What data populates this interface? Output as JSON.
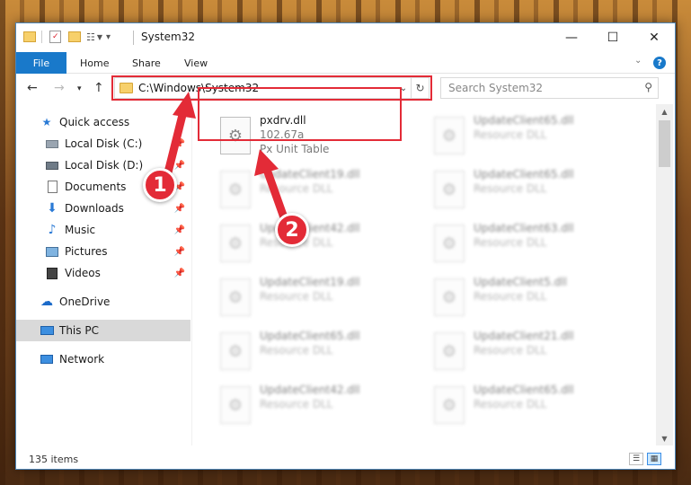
{
  "window": {
    "title": "System32",
    "controls": {
      "minimize": "—",
      "maximize": "☐",
      "close": "✕"
    }
  },
  "ribbon": {
    "tabs": [
      "File",
      "Home",
      "Share",
      "View"
    ],
    "help": "?"
  },
  "nav": {
    "address": "C:\\Windows\\System32",
    "search_placeholder": "Search System32"
  },
  "sidebar": {
    "items": [
      {
        "label": "Quick access",
        "icon": "star-icon"
      },
      {
        "label": "Local Disk (C:)",
        "icon": "drive-icon",
        "pinned": true
      },
      {
        "label": "Local Disk (D:)",
        "icon": "drive-icon",
        "pinned": true
      },
      {
        "label": "Documents",
        "icon": "documents-icon",
        "pinned": true
      },
      {
        "label": "Downloads",
        "icon": "download-icon",
        "pinned": true
      },
      {
        "label": "Music",
        "icon": "music-icon",
        "pinned": true
      },
      {
        "label": "Pictures",
        "icon": "pictures-icon",
        "pinned": true
      },
      {
        "label": "Videos",
        "icon": "videos-icon",
        "pinned": true
      },
      {
        "label": "OneDrive",
        "icon": "cloud-icon"
      },
      {
        "label": "This PC",
        "icon": "computer-icon"
      },
      {
        "label": "Network",
        "icon": "network-icon"
      }
    ]
  },
  "files": {
    "highlighted": {
      "name": "pxdrv.dll",
      "version": "102.67a",
      "description": "Px Unit Table"
    },
    "col1": [
      {
        "name": "UpdateClient19.dll",
        "type": "Resource DLL"
      },
      {
        "name": "UpdateClient42.dll",
        "type": "Resource DLL"
      },
      {
        "name": "UpdateClient19.dll",
        "type": "Resource DLL"
      },
      {
        "name": "UpdateClient65.dll",
        "type": "Resource DLL"
      },
      {
        "name": "UpdateClient42.dll",
        "type": "Resource DLL"
      }
    ],
    "col2": [
      {
        "name": "UpdateClient65.dll",
        "type": "Resource DLL"
      },
      {
        "name": "UpdateClient65.dll",
        "type": "Resource DLL"
      },
      {
        "name": "UpdateClient63.dll",
        "type": "Resource DLL"
      },
      {
        "name": "UpdateClient5.dll",
        "type": "Resource DLL"
      },
      {
        "name": "UpdateClient21.dll",
        "type": "Resource DLL"
      },
      {
        "name": "UpdateClient65.dll",
        "type": "Resource DLL"
      }
    ]
  },
  "status": {
    "items_count": "135 items"
  },
  "annotations": {
    "step1": "1",
    "step2": "2",
    "color": "#e32b37"
  }
}
